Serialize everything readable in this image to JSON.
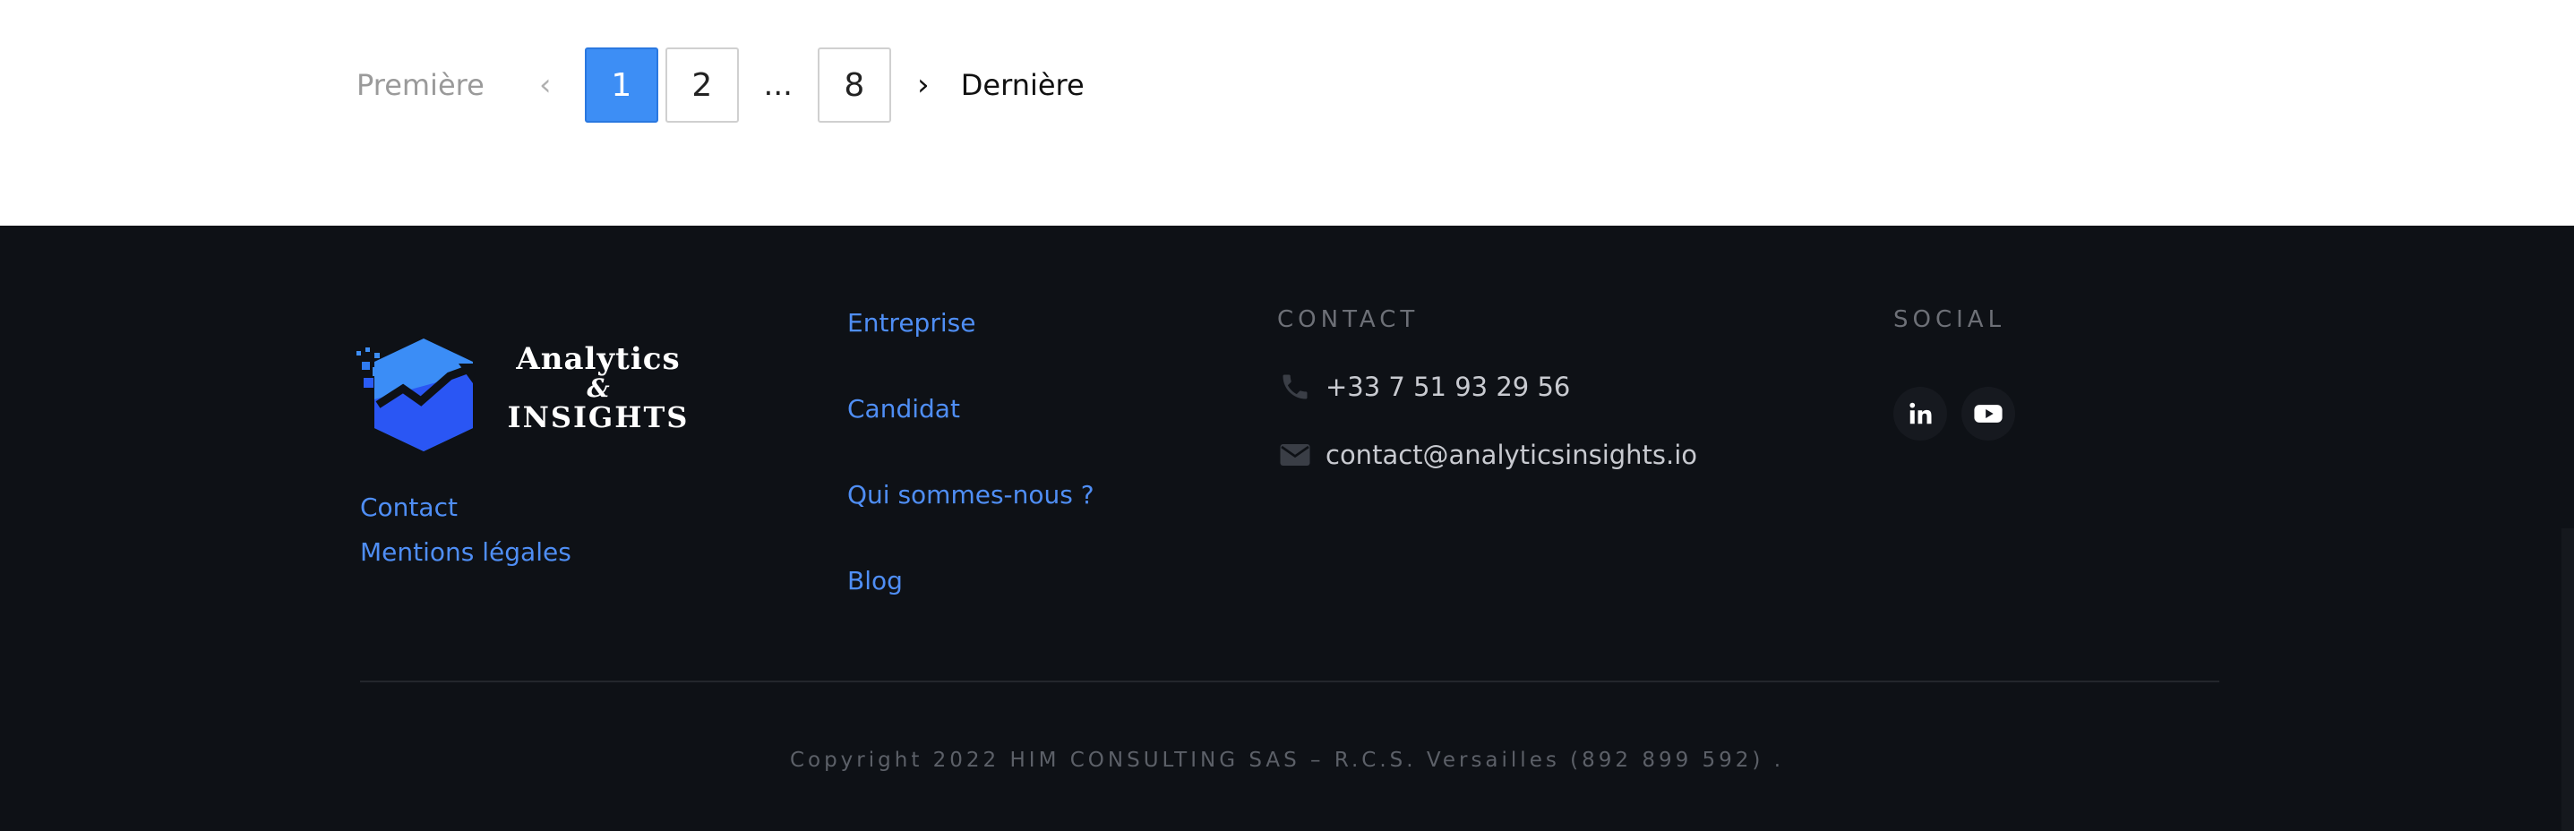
{
  "pagination": {
    "first_label": "Première",
    "prev_label": "‹",
    "pages": [
      "1",
      "2"
    ],
    "active_page": "1",
    "ellipsis": "...",
    "last_page": "8",
    "next_label": "›",
    "last_label": "Dernière"
  },
  "footer": {
    "logo": {
      "line1": "Analytics",
      "amp": "&",
      "line3": "INSIGHTS"
    },
    "left_links": [
      "Contact",
      "Mentions légales"
    ],
    "mid_links": [
      "Entreprise",
      "Candidat",
      "Qui sommes-nous ?",
      "Blog"
    ],
    "contact": {
      "heading": "CONTACT",
      "phone": "+33 7 51 93 29 56",
      "email": "contact@analyticsinsights.io",
      "phone_icon": "phone-icon",
      "email_icon": "envelope-icon"
    },
    "social": {
      "heading": "SOCIAL",
      "icons": [
        "linkedin-icon",
        "youtube-icon"
      ]
    },
    "copyright": "Copyright 2022 HIM CONSULTING SAS – R.C.S. Versailles (892 899 592) ."
  },
  "colors": {
    "accent": "#3d8ef5",
    "link": "#4f8ef5",
    "footer_bg": "#0e1116"
  }
}
